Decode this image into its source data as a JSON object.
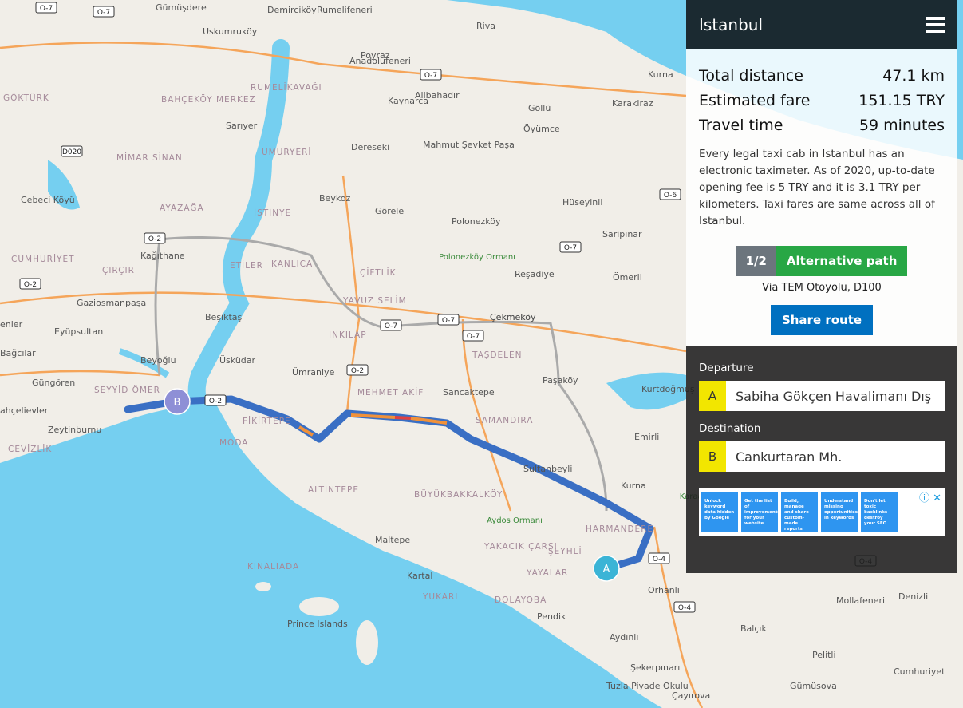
{
  "header": {
    "title": "Istanbul",
    "menu_icon": "hamburger-icon"
  },
  "summary": [
    {
      "label": "Total distance",
      "value": "47.1 km"
    },
    {
      "label": "Estimated fare",
      "value": "151.15 TRY"
    },
    {
      "label": "Travel time",
      "value": "59 minutes"
    }
  ],
  "description": "Every legal taxi cab in Istanbul has an electronic taximeter. As of 2020, up-to-date opening fee is 5 TRY and it is 3.1 TRY per kilometers. Taxi fares are same across all of Istanbul.",
  "route": {
    "counter": "1/2",
    "alt_label": "Alternative path",
    "via": "Via TEM Otoyolu, D100",
    "share_label": "Share route"
  },
  "departure": {
    "label": "Departure",
    "badge": "A",
    "value": "Sabiha Gökçen Havalimanı Dış Hat"
  },
  "destination": {
    "label": "Destination",
    "badge": "B",
    "value": "Cankurtaran Mh."
  },
  "ad": {
    "cards": [
      "Unlock keyword data hidden by Google",
      "Get the list of improvements for your website",
      "Build, manage and share custom-made reports",
      "Understand missing opportunities in keywords",
      "Don't let toxic backlinks destroy your SEO"
    ],
    "icons": "ⓘ ✕"
  },
  "map": {
    "markers": {
      "a": "A",
      "b": "B"
    },
    "colors": {
      "water": "#75cff0",
      "land": "#f1eee8",
      "route": "#3a6fc4",
      "traffic": "#f0913a"
    },
    "places": [
      "Gümüşdere",
      "Demirciköy",
      "Rumelifeneri",
      "Uskumruköy",
      "Riva",
      "Anadolufeneri",
      "Poyraz",
      "RUMELİKAVAĞI",
      "Kaynarca",
      "Alibahadır",
      "Göllü",
      "Kurna",
      "Karakiraz",
      "GÖKTÜRK",
      "BAHÇEKÖY MERKEZ",
      "Sarıyer",
      "Dereseki",
      "Mahmut Şevket Paşa",
      "Öyümce",
      "UMURYERİ",
      "MİMAR SİNAN",
      "Cebeci Köyü",
      "AYAZAĞA",
      "İSTİNYE",
      "Beykoz",
      "Görele",
      "Polonezköy",
      "Hüseyinli",
      "Kağıthane",
      "KANLICA",
      "ETİLER",
      "ÇİFTLİK",
      "Saripınar",
      "Reşadiye",
      "Ömerli",
      "CUMHURİYET",
      "ÇIRÇIR",
      "YAVUZ SELİM",
      "Gaziosmanpaşa",
      "Eyüpsultan",
      "Beşiktaş",
      "INKILAP",
      "Çekmeköy",
      "TAŞDELEN",
      "Bağcılar",
      "Beyoğlu",
      "Üsküdar",
      "Ümraniye",
      "Paşaköy",
      "Güngören",
      "SEYYİD ÖMER",
      "MEHMET AKİF",
      "Sancaktepe",
      "Kurtdoğmuş",
      "ahçelievler",
      "FİKİRTEPE",
      "SAMANDIRA",
      "Emirli",
      "Zeytinburnu",
      "MODA",
      "CEVİZLİK",
      "Sultanbeyli",
      "Kurna",
      "ALTINTEPE",
      "BÜYÜKBAKKALKÖY",
      "HARMANDERE",
      "Maltepe",
      "YAKACIK ÇARŞI",
      "ŞEYHLİ",
      "KINALIADA",
      "Kartal",
      "YAYALAR",
      "YUKARI",
      "DOLAYOBA",
      "Orhanlı",
      "Mollafeneri",
      "Denizli",
      "Pendik",
      "Prince Islands",
      "Balçık",
      "Aydınlı",
      "Pelitli",
      "Şekerpınarı",
      "Cumhuriyet",
      "Tuzla Piyade Okulu",
      "Çayırova",
      "Gümüşova",
      "enler",
      "Çekmeköy"
    ],
    "parks": [
      "Polonezköy Ormanı",
      "Aydos Ormanı",
      "Karaağıl Devlet Ormanı"
    ],
    "shields": [
      "O-7",
      "O-7",
      "O-7",
      "D020",
      "O-2",
      "O-7",
      "O-7",
      "O-7",
      "O-2",
      "O-2",
      "O-6",
      "O-7",
      "O-4",
      "O-4",
      "O-4",
      "O-2"
    ]
  }
}
